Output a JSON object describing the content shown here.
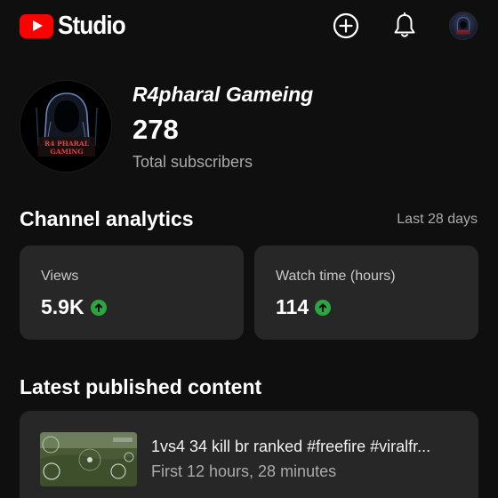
{
  "header": {
    "app_name": "Studio",
    "icons": [
      "create-icon",
      "notifications-bell-icon",
      "account-avatar"
    ]
  },
  "channel": {
    "name": "R4pharal Gameing",
    "subscriber_count": "278",
    "subscriber_label": "Total subscribers",
    "avatar_text_line1": "R4 PHARAL",
    "avatar_text_line2": "GAMING"
  },
  "analytics": {
    "title": "Channel analytics",
    "period": "Last 28 days",
    "cards": [
      {
        "label": "Views",
        "value": "5.9K",
        "trend": "up"
      },
      {
        "label": "Watch time (hours)",
        "value": "114",
        "trend": "up"
      }
    ]
  },
  "latest": {
    "title": "Latest published content",
    "video": {
      "title": "1vs4 34 kill br ranked #freefire  #viralfr...",
      "meta": "First 12 hours, 28 minutes"
    }
  },
  "colors": {
    "background": "#0f0f0f",
    "card": "#272727",
    "brand_red": "#ff0000",
    "trend_green": "#2ba640",
    "secondary_text": "#aaaaaa"
  }
}
